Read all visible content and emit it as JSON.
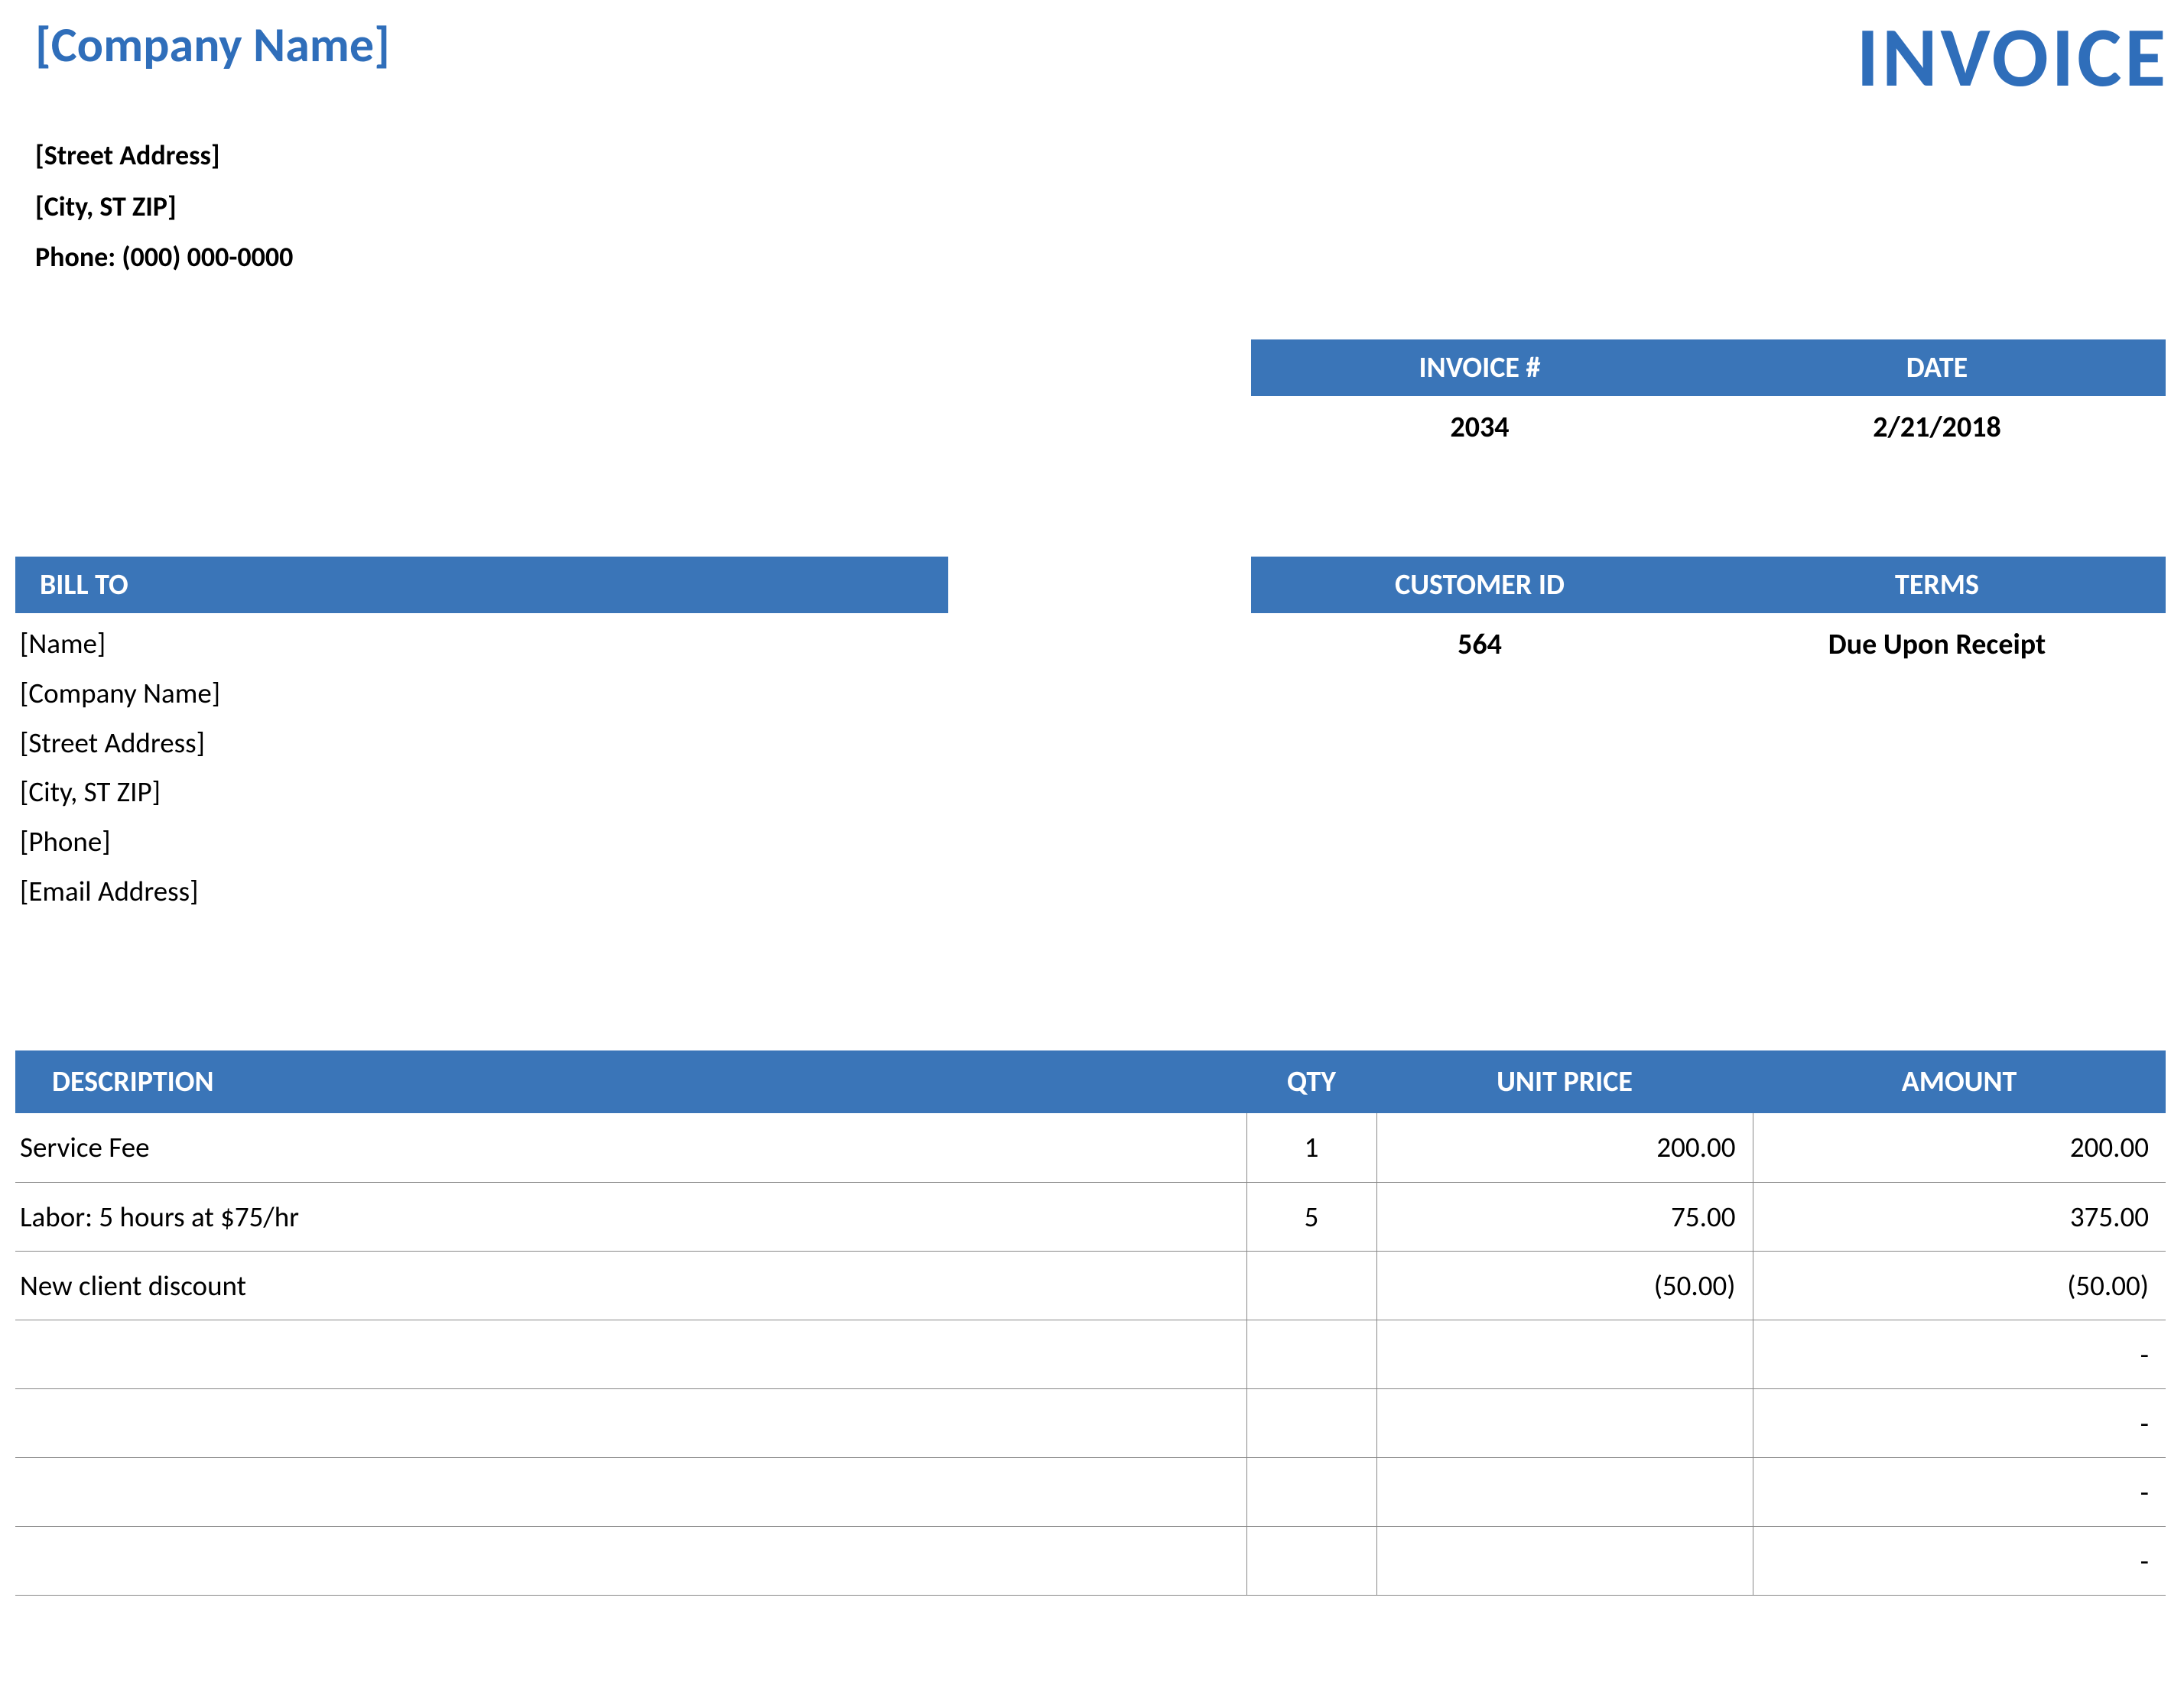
{
  "company": {
    "name": "[Company Name]",
    "street": "[Street Address]",
    "city_st_zip": "[City, ST  ZIP]",
    "phone": "Phone: (000) 000-0000"
  },
  "title": "INVOICE",
  "meta1": {
    "labels": {
      "invoice_no": "INVOICE #",
      "date": "DATE"
    },
    "invoice_no": "2034",
    "date": "2/21/2018"
  },
  "meta2": {
    "labels": {
      "customer_id": "CUSTOMER ID",
      "terms": "TERMS"
    },
    "customer_id": "564",
    "terms": "Due Upon Receipt"
  },
  "bill_to": {
    "label": "BILL TO",
    "lines": {
      "name": "[Name]",
      "company": "[Company Name]",
      "street": "[Street Address]",
      "city_st_zip": "[City, ST  ZIP]",
      "phone": "[Phone]",
      "email": "[Email Address]"
    }
  },
  "items": {
    "headers": {
      "description": "DESCRIPTION",
      "qty": "QTY",
      "unit_price": "UNIT PRICE",
      "amount": "AMOUNT"
    },
    "rows": [
      {
        "description": "Service Fee",
        "qty": "1",
        "unit_price": "200.00",
        "amount": "200.00"
      },
      {
        "description": "Labor: 5 hours at $75/hr",
        "qty": "5",
        "unit_price": "75.00",
        "amount": "375.00"
      },
      {
        "description": "New client discount",
        "qty": "",
        "unit_price": "(50.00)",
        "amount": "(50.00)"
      },
      {
        "description": "",
        "qty": "",
        "unit_price": "",
        "amount": "-"
      },
      {
        "description": "",
        "qty": "",
        "unit_price": "",
        "amount": "-"
      },
      {
        "description": "",
        "qty": "",
        "unit_price": "",
        "amount": "-"
      },
      {
        "description": "",
        "qty": "",
        "unit_price": "",
        "amount": "-"
      }
    ]
  }
}
